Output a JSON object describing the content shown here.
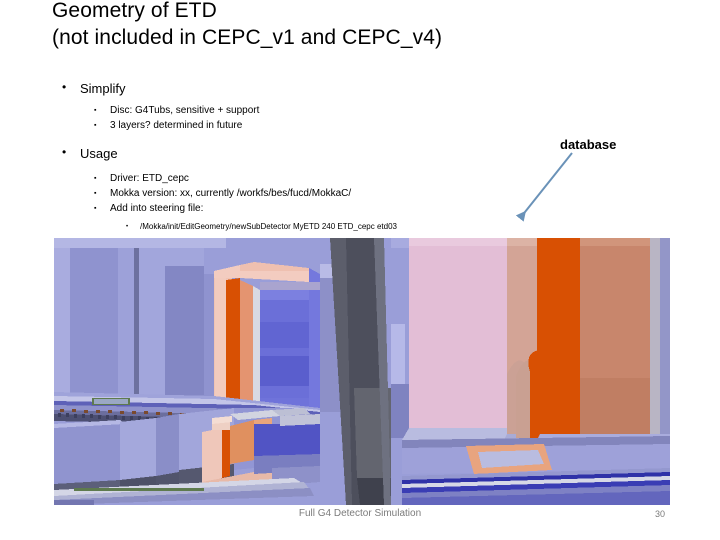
{
  "slide": {
    "title": "Geometry of ETD\n(not included in CEPC_v1 and CEPC_v4)",
    "bullets": {
      "simplify": "Simplify",
      "simplify_sub": [
        "Disc: G4Tubs, sensitive + support",
        "3 layers? determined in future"
      ],
      "usage": "Usage",
      "usage_sub": [
        "Driver: ETD_cepc",
        "Mokka version: xx, currently /workfs/bes/fucd/MokkaC/",
        "Add into steering file:"
      ],
      "steering_command": "/Mokka/init/EditGeometry/newSubDetector MyETD 240 ETD_cepc etd03"
    },
    "bullet_glyphs": {
      "level1": "•",
      "level2": "▪",
      "level3": "•"
    },
    "callout": {
      "label": "database",
      "arrow_color": "#6a92b8"
    },
    "picture": {
      "alt": "Full G4 detector geometry render of the ETD region",
      "palette": {
        "lavender": "#8e92cf",
        "lavender_light": "#a7aade",
        "lavender_dark": "#7b7fbe",
        "periwinkle": "#9a9ed8",
        "blue_violet": "#6b6fd8",
        "blue_deep": "#5356c9",
        "slate_dark": "#4d4f5c",
        "slate_mid": "#6e7180",
        "slate_light": "#9093a5",
        "pink": "#e3bed6",
        "pink_pale": "#f0c9c4",
        "salmon": "#e8a188",
        "orange": "#d85003",
        "orange_mid": "#e0723a",
        "tan": "#c8866c",
        "grey_pale": "#cfd0da",
        "white_soft": "#e9eaf2"
      }
    },
    "footer": {
      "caption": "Full G4 Detector Simulation",
      "page_number": "30"
    }
  }
}
